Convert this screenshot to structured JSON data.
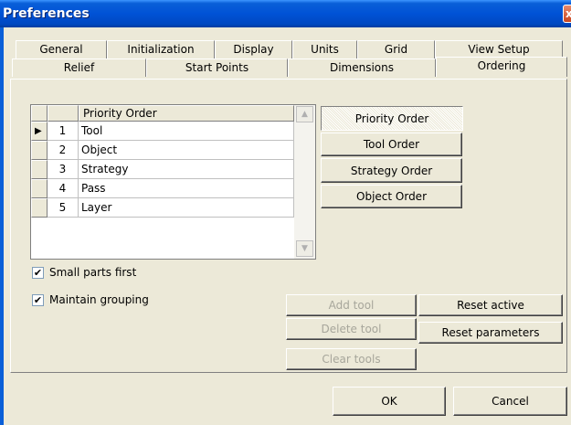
{
  "window": {
    "title": "Preferences",
    "close_glyph": "x"
  },
  "tabs_row1": [
    {
      "label": "General"
    },
    {
      "label": "Initialization"
    },
    {
      "label": "Display"
    },
    {
      "label": "Units"
    },
    {
      "label": "Grid"
    },
    {
      "label": "View Setup"
    }
  ],
  "tabs_row2": [
    {
      "label": "Relief"
    },
    {
      "label": "Start Points"
    },
    {
      "label": "Dimensions"
    },
    {
      "label": "Ordering",
      "active": true
    }
  ],
  "grid": {
    "header": "Priority Order",
    "rows": [
      {
        "num": "1",
        "value": "Tool",
        "current": true
      },
      {
        "num": "2",
        "value": "Object"
      },
      {
        "num": "3",
        "value": "Strategy"
      },
      {
        "num": "4",
        "value": "Pass"
      },
      {
        "num": "5",
        "value": "Layer"
      }
    ],
    "current_row_glyph": "▶",
    "scroll_up_glyph": "▲",
    "scroll_down_glyph": "▼"
  },
  "order_buttons": {
    "priority": "Priority Order",
    "tool": "Tool Order",
    "strategy": "Strategy Order",
    "object": "Object Order"
  },
  "options": {
    "small_parts_first": {
      "label": "Small parts first",
      "checked": true
    },
    "maintain_grouping": {
      "label": "Maintain grouping",
      "checked": true
    },
    "check_glyph": "✔"
  },
  "tool_buttons": {
    "add_tool": "Add tool",
    "delete_tool": "Delete tool",
    "clear_tools": "Clear tools",
    "reset_active": "Reset active",
    "reset_parameters": "Reset parameters"
  },
  "dialog_buttons": {
    "ok": "OK",
    "cancel": "Cancel"
  }
}
